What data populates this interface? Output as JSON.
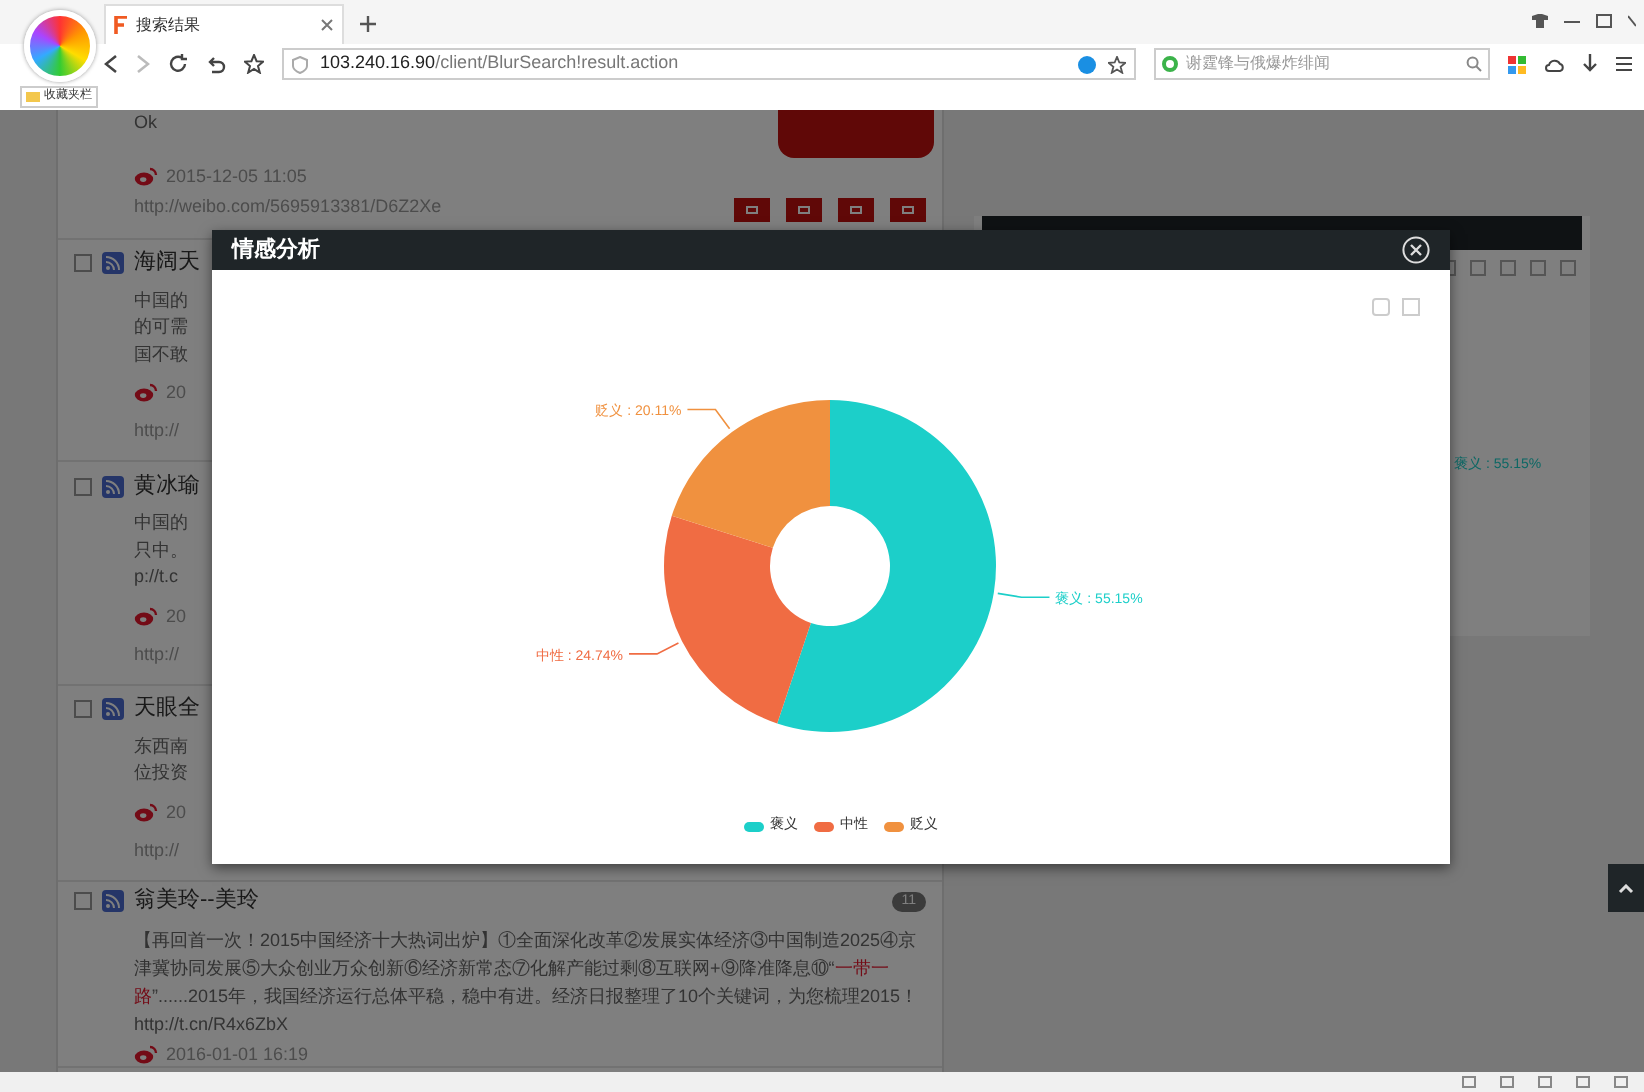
{
  "browser": {
    "tab_title": "搜索结果",
    "address_host": "103.240.16.90",
    "address_path": "/client/BlurSearch!result.action",
    "search_placeholder": "谢霆锋与俄爆炸绯闻",
    "bookmarks": [
      "收藏夹栏"
    ]
  },
  "posts": [
    {
      "kind": "scrolled",
      "lines": [
        "Ok"
      ],
      "date": "2015-12-05 11:05",
      "url": "http://weibo.com/5695913381/D6Z2Xe"
    },
    {
      "kind": "covered",
      "checked": false,
      "title": "海阔天",
      "lines": [
        "中国的",
        "的可需",
        "国不敢"
      ],
      "date": "20",
      "url": "http://"
    },
    {
      "kind": "covered",
      "checked": false,
      "title": "黄冰瑜",
      "lines": [
        "中国的",
        "只中。",
        "p://t.c"
      ],
      "date": "20",
      "url": "http://"
    },
    {
      "kind": "covered",
      "checked": false,
      "title": "天眼全",
      "lines": [
        "东西南",
        "位投资"
      ],
      "date": "20",
      "url": "http://"
    },
    {
      "kind": "full",
      "checked": false,
      "title": "翁美玲--美玲",
      "badge": "11",
      "segments": [
        {
          "text": "【再回首一次！2015中国经济十大热词出炉】①全面深化改革②发展实体经济③中国制造2025④京津冀协同发展⑤大众创业万众创新⑥经济新常态⑦化解产能过剩⑧互联网+⑨降准降息⑩“",
          "highlight": false
        },
        {
          "text": "一带一路",
          "highlight": true
        },
        {
          "text": "”......2015年，我国经济运行总体平稳，稳中有进。经济日报整理了10个关键词，为您梳理2015！http://t.cn/R4x6ZbX",
          "highlight": false
        }
      ],
      "date": "2016-01-01 16:19"
    }
  ],
  "right_panel": {
    "label": "褒义 : 55.15%"
  },
  "modal": {
    "title": "情感分析",
    "chart_data": {
      "type": "donut",
      "categories": [
        "褒义",
        "中性",
        "贬义"
      ],
      "values": [
        55.15,
        24.74,
        20.11
      ],
      "value_labels": [
        "褒义 : 55.15%",
        "中性 : 24.74%",
        "贬义 : 20.11%"
      ]
    },
    "legend": [
      {
        "color": "#1ccfc9"
      },
      {
        "color": "#f06c43"
      },
      {
        "color": "#f0913f"
      }
    ]
  }
}
